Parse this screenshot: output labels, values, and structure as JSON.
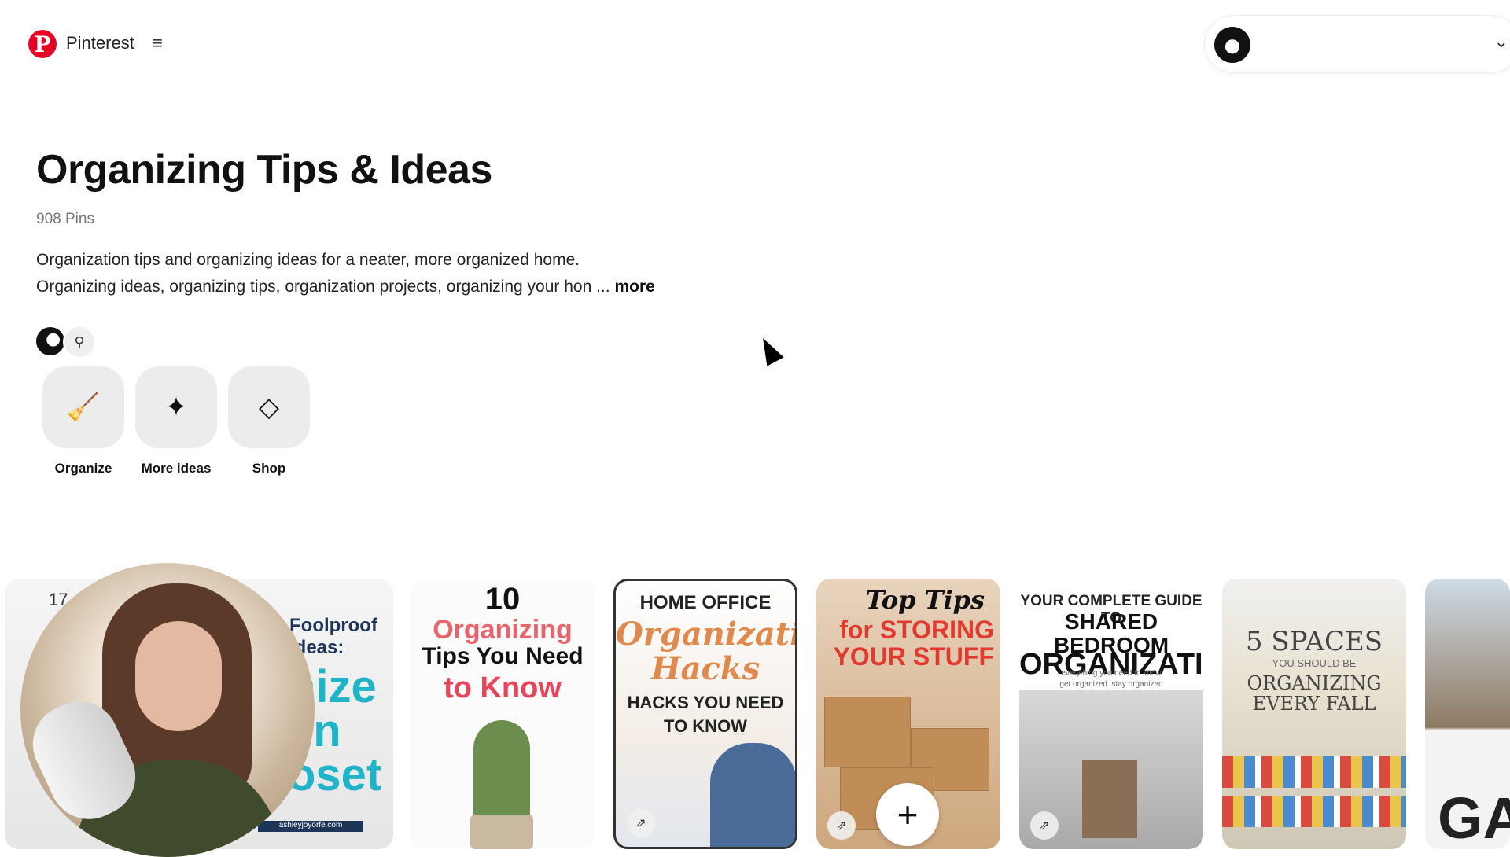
{
  "header": {
    "logo_glyph": "P",
    "brand": "Pinterest",
    "menu_glyph": "≡",
    "account_chevron": "⌄"
  },
  "board": {
    "title": "Organizing Tips & Ideas",
    "pin_count": "908 Pins",
    "description_line1": "Organization tips and organizing ideas for a neater, more organized home.",
    "description_line2": "Organizing ideas, organizing tips, organization projects, organizing your hon ...",
    "more_label": "more",
    "invite_glyph": "⚲"
  },
  "actions": [
    {
      "label": "Organize",
      "icon": "broom-sparkle-icon",
      "glyph": "🧹"
    },
    {
      "label": "More ideas",
      "icon": "sparkle-icon",
      "glyph": "✦"
    },
    {
      "label": "Shop",
      "icon": "tag-icon",
      "glyph": "◇"
    }
  ],
  "pins": {
    "p1": {
      "num": "17",
      "small": "Foolproof\nIdeas:",
      "big": "nize\nen\noset",
      "url": "ashleyjoyorfe.com"
    },
    "p2": {
      "l1": "10",
      "l2": "Organizing",
      "l3": "Tips You Need",
      "l4": "to Know"
    },
    "p3": {
      "l1": "HOME OFFICE",
      "l2": "Organization Hacks",
      "l3": "HACKS YOU NEED TO KNOW"
    },
    "p4": {
      "l1": "Top Tips",
      "l2": "for STORING YOUR STUFF",
      "add_glyph": "+"
    },
    "p5": {
      "l1": "YOUR COMPLETE GUIDE TO",
      "l2": "SHARED BEDROOM",
      "l3": "ORGANIZATION",
      "l4": "everything you need to know\nget organized. stay organized"
    },
    "p6": {
      "l1": "5 SPACES",
      "l2": "YOU SHOULD BE",
      "l3": "ORGANIZING EVERY FALL"
    },
    "p7": {
      "l1": "GAR"
    },
    "stat_glyph": "⇗"
  },
  "colors": {
    "brand_red": "#e60023",
    "action_bg": "#ececec",
    "muted_text": "#767676"
  }
}
